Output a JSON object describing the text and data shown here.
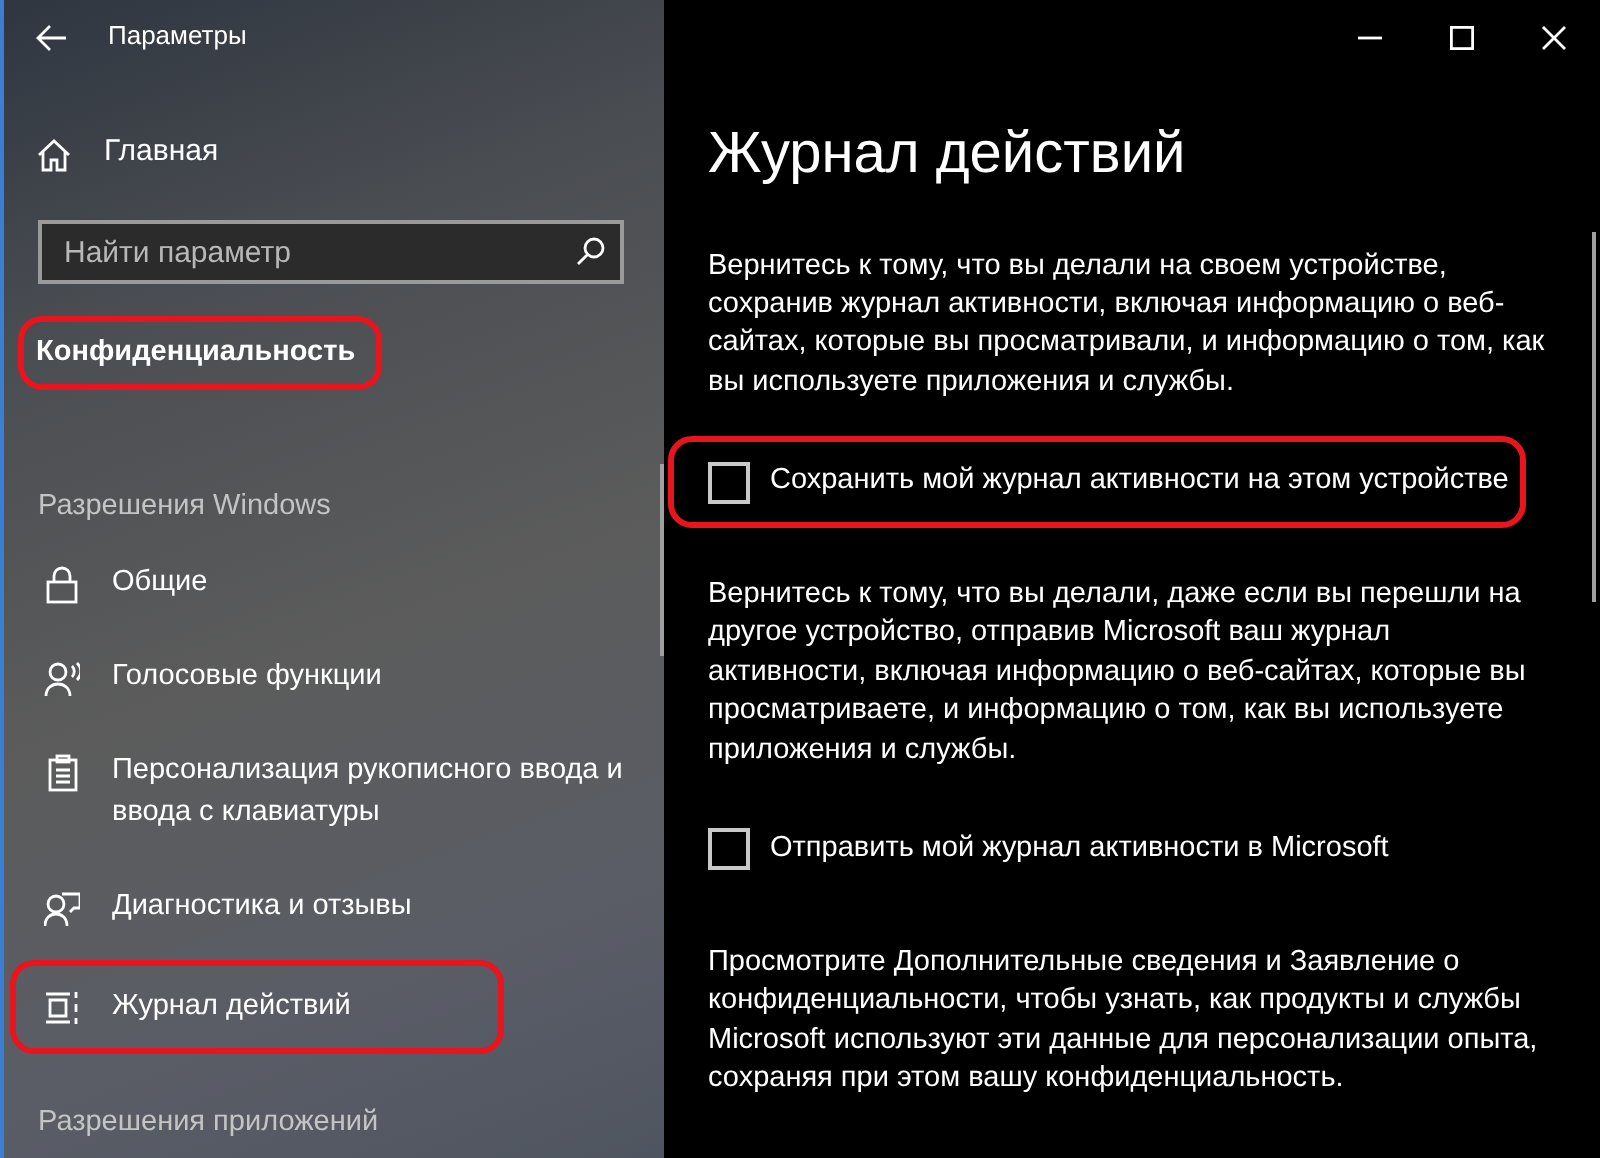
{
  "window": {
    "title": "Параметры"
  },
  "sidebar": {
    "home": {
      "label": "Главная"
    },
    "search": {
      "placeholder": "Найти параметр"
    },
    "category": {
      "label": "Конфиденциальность",
      "highlighted": true
    },
    "sections": [
      {
        "title": "Разрешения Windows",
        "items": [
          {
            "label": "Общие",
            "highlighted": false
          },
          {
            "label": "Голосовые функции",
            "highlighted": false
          },
          {
            "label": "Персонализация рукописного ввода и ввода с клавиатуры",
            "highlighted": false
          },
          {
            "label": "Диагностика и отзывы",
            "highlighted": false
          },
          {
            "label": "Журнал действий",
            "highlighted": true
          }
        ]
      },
      {
        "title": "Разрешения приложений"
      }
    ]
  },
  "main": {
    "title": "Журнал действий",
    "blocks": [
      {
        "kind": "paragraph",
        "text": "Вернитесь к тому, что вы делали на своем устройстве, сохранив журнал активности, включая информацию о веб-сайтах, которые вы просматривали, и информацию о том, как вы используете приложения и службы."
      },
      {
        "kind": "checkbox",
        "label": "Сохранить мой журнал активности на этом устройстве",
        "checked": false,
        "highlighted": true
      },
      {
        "kind": "paragraph",
        "text": "Вернитесь к тому, что вы делали, даже если вы перешли на другое устройство, отправив Microsoft ваш журнал активности, включая информацию о веб-сайтах, которые вы просматриваете, и информацию о том, как вы используете приложения и службы."
      },
      {
        "kind": "checkbox",
        "label": "Отправить мой журнал активности в Microsoft",
        "checked": false,
        "highlighted": false
      },
      {
        "kind": "paragraph",
        "text": "Просмотрите Дополнительные сведения и Заявление о конфиденциальности, чтобы узнать, как продукты и службы Microsoft используют эти данные для персонализации опыта, сохраняя при этом вашу конфиденциальность."
      }
    ]
  }
}
